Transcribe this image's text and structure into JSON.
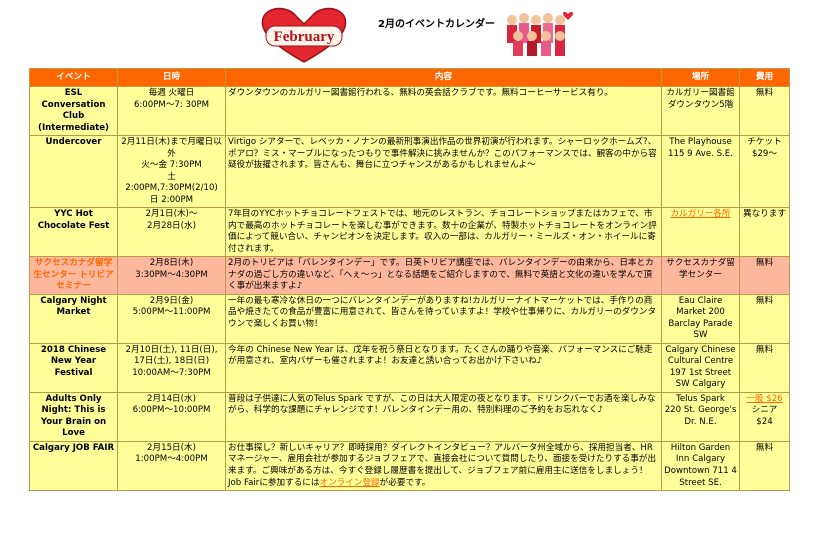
{
  "header": {
    "logo_text": "February",
    "title": "2月のイベントカレンダー"
  },
  "columns": [
    "イベント",
    "日時",
    "内容",
    "場所",
    "費用"
  ],
  "rows": [
    {
      "event": "ESL Conversation Club (Intermediate)",
      "datetime": "毎週 火曜日\n6:00PM〜7: 30PM",
      "description": "ダウンタウンのカルガリー図書館行われる、無料の英会話クラブです。無料コーヒーサービス有り。",
      "place": "カルガリー図書館ダウンタウン5階",
      "fee": "無料",
      "highlight": false
    },
    {
      "event": "Undercover",
      "datetime": "2月11日(木)まで月曜日以外\n火〜金 7:30PM\n土\n2:00PM,7:30PM(2/10)\n日 2:00PM",
      "description": "Virtigo シアターで、レベッカ・ノナンの最新刑事演出作品の世界初演が行われます。シャーロックホームズ?、ポアロ？ミス・マープルになったつもりで事件解決に挑みませんか？このパフォーマンスでは、観客の中から容疑役が抜擢されます。皆さんも、舞台に立つチャンスがあるかもしれませんよ〜",
      "place": "The Playhouse\n115 9 Ave. S.E.",
      "fee": "チケット\n$29〜",
      "highlight": false
    },
    {
      "event": "YYC Hot Chocolate Fest",
      "datetime": "2月1日(木)〜\n2月28日(水)",
      "description": "7年目のYYCホットチョコレートフェストでは、地元のレストラン、チョコレートショップまたはカフェで、市内で最高のホットチョコレートを楽しむ事ができます。数十の企業が、特製ホットチョコレートをオンライン評価によって競い合い、チャンピオンを決定します。収入の一部は、カルガリー・ミールズ・オン・ホイールに寄付されます。",
      "place": "カルガリー各所",
      "place_link": true,
      "fee": "異なります",
      "highlight": false
    },
    {
      "event": "サクセスカナダ留学生センター トリビアセミナー",
      "datetime": "2月8日(木)\n3:30PM〜4:30PM",
      "description": "2月のトリビアは「バレンタインデー」です。日英トリビア講座では、バレンタインデーの由来から、日本とカナダの過ごし方の違いなど、「へぇ〜っ」となる話題をご紹介しますので、無料で英語と文化の違いを学んで頂く事が出来ますよ♪",
      "place": "サクセスカナダ留学センター",
      "fee": "無料",
      "highlight": true
    },
    {
      "event": "Calgary Night Market",
      "datetime": "2月9日(金)\n5:00PM〜11:00PM",
      "description": "一年の最も寒冷な休日の一つにバレンタインデーがありますね!カルガリーナイトマーケットでは、手作りの商品や焼きたての食品が豊富に用意されて、皆さんを待っていますよ！学校や仕事帰りに、カルガリーのダウンタウンで楽しくお買い物！",
      "place": "Eau Claire Market 200 Barclay Parade SW",
      "fee": "無料",
      "highlight": false
    },
    {
      "event": "2018 Chinese New Year Festival",
      "datetime": "2月10日(土), 11日(日),\n17日(土), 18日(日)\n10:00AM〜7:30PM",
      "description": "今年の Chinese New Year は、戊年を祝う祭日となります。たくさんの踊りや音楽、パフォーマンスにご馳走が用意され、室内バザーも催されますよ！お友達と誘い合ってお出かけ下さいね♪",
      "place": "Calgary Chinese Cultural Centre\n197 1st Street SW Calgary",
      "fee": "無料",
      "highlight": false
    },
    {
      "event": "Adults Only Night: This is Your Brain on Love",
      "datetime": "2月14日(水)\n6:00PM〜10:00PM",
      "description": "普段は子供達に人気のTelus Spark ですが、この日は大人限定の夜となります。ドリンクバーでお酒を楽しみながら、科学的な課題にチャレンジです！バレンタインデー用の、特別料理のご予約をお忘れなく♪",
      "place": "Telus Spark\n220 St. George's Dr. N.E.",
      "fee_link": "一般 $26",
      "fee": "シニア\n$24",
      "highlight": false
    },
    {
      "event": "Calgary JOB FAIR",
      "datetime": "2月15日(木)\n1:00PM〜4:00PM",
      "description": "お仕事探し？新しいキャリア？即時採用？ダイレクトインタビュー？アルバータ州全域から、採用担当者、HRマネージャー、雇用会社が参加するジョブフェアで、直接会社について質問したり、面接を受けたりする事が出来ます。ご興味がある方は、今すぐ登録し履歴書を提出して、ジョブフェア前に雇用主に送信をしましょう！Job Fairに参加するには",
      "description_link": "オンライン登録",
      "description_suffix": "が必要です。",
      "place": "Hilton Garden Inn Calgary Downtown 711 4 Street SE.",
      "fee": "無料",
      "highlight": false
    }
  ],
  "colors": {
    "header_bg": "#ff6600",
    "row_bg": "#ffff99",
    "highlight_bg": "#fcb79c",
    "border": "#b89a4a"
  }
}
